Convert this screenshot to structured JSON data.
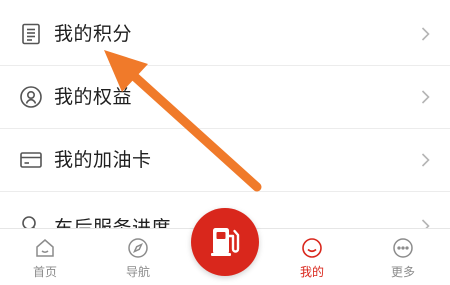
{
  "menu": {
    "items": [
      {
        "label": "我的积分",
        "icon": "document-list-icon"
      },
      {
        "label": "我的权益",
        "icon": "user-badge-icon"
      },
      {
        "label": "我的加油卡",
        "icon": "card-icon"
      },
      {
        "label": "车后服务进度",
        "icon": "search-icon"
      }
    ]
  },
  "tabbar": {
    "tabs": [
      {
        "label": "首页",
        "icon": "home-icon"
      },
      {
        "label": "导航",
        "icon": "compass-icon"
      },
      {
        "label": "",
        "icon": "fuel-pump-icon"
      },
      {
        "label": "我的",
        "icon": "smile-icon"
      },
      {
        "label": "更多",
        "icon": "more-dots-icon"
      }
    ]
  },
  "colors": {
    "accent": "#d9271c",
    "annotation_arrow": "#f07a2a",
    "inactive": "#8c8c8c"
  }
}
